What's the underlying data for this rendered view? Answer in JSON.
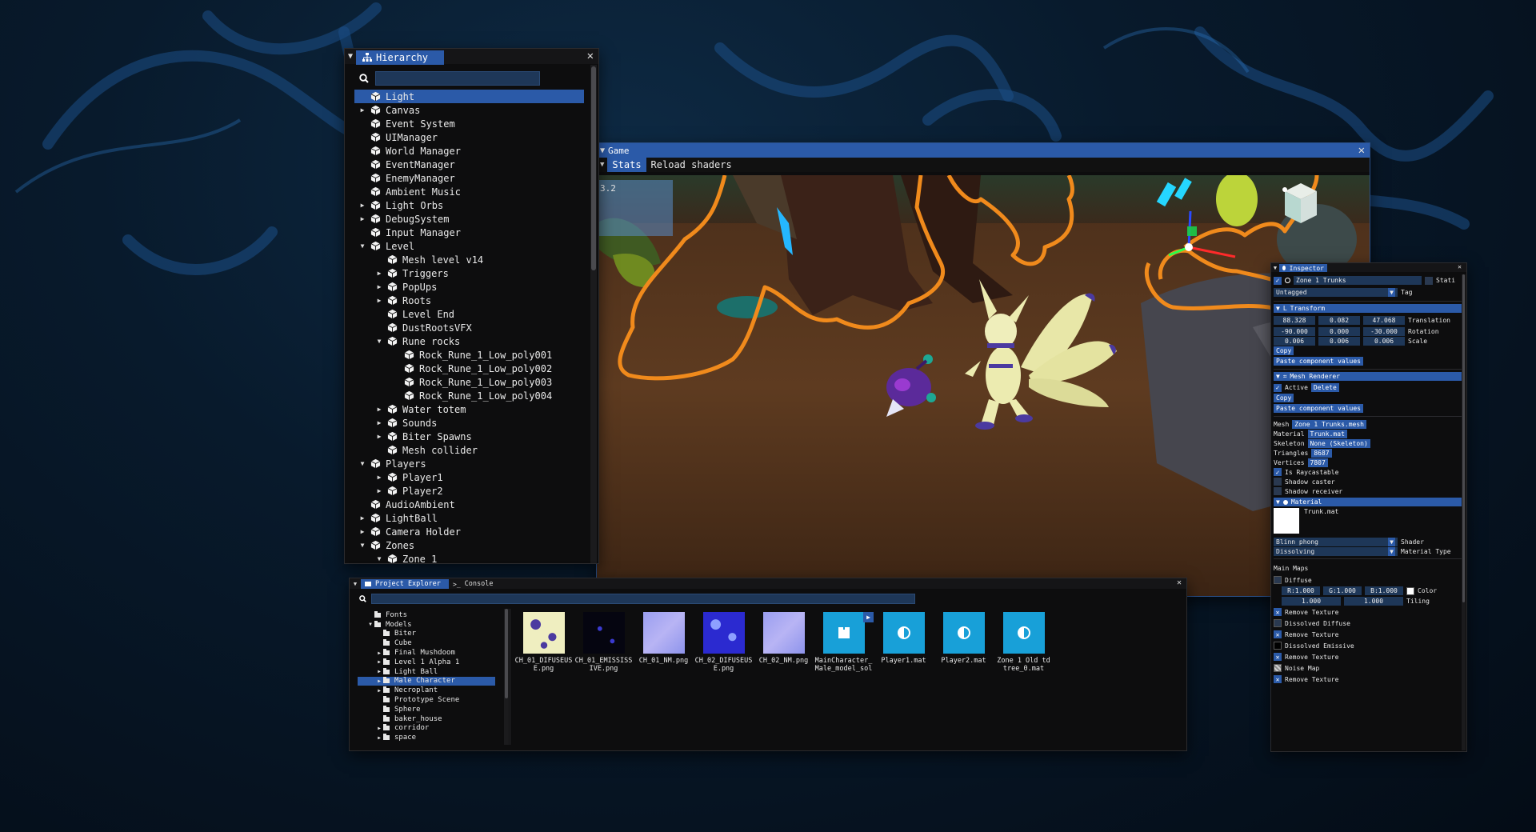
{
  "hierarchy": {
    "title": "Hierarchy",
    "items": [
      {
        "label": "Light",
        "depth": 0,
        "arrow": "",
        "selected": true
      },
      {
        "label": "Canvas",
        "depth": 0,
        "arrow": "▶"
      },
      {
        "label": "Event System",
        "depth": 0,
        "arrow": ""
      },
      {
        "label": "UIManager",
        "depth": 0,
        "arrow": ""
      },
      {
        "label": "World Manager",
        "depth": 0,
        "arrow": ""
      },
      {
        "label": "EventManager",
        "depth": 0,
        "arrow": ""
      },
      {
        "label": "EnemyManager",
        "depth": 0,
        "arrow": ""
      },
      {
        "label": "Ambient Music",
        "depth": 0,
        "arrow": ""
      },
      {
        "label": "Light Orbs",
        "depth": 0,
        "arrow": "▶"
      },
      {
        "label": "DebugSystem",
        "depth": 0,
        "arrow": "▶"
      },
      {
        "label": "Input Manager",
        "depth": 0,
        "arrow": ""
      },
      {
        "label": "Level",
        "depth": 0,
        "arrow": "▼"
      },
      {
        "label": "Mesh level v14",
        "depth": 1,
        "arrow": ""
      },
      {
        "label": "Triggers",
        "depth": 1,
        "arrow": "▶"
      },
      {
        "label": "PopUps",
        "depth": 1,
        "arrow": "▶"
      },
      {
        "label": "Roots",
        "depth": 1,
        "arrow": "▶"
      },
      {
        "label": "Level End",
        "depth": 1,
        "arrow": ""
      },
      {
        "label": "DustRootsVFX",
        "depth": 1,
        "arrow": ""
      },
      {
        "label": "Rune rocks",
        "depth": 1,
        "arrow": "▼"
      },
      {
        "label": "Rock_Rune_1_Low_poly001",
        "depth": 2,
        "arrow": ""
      },
      {
        "label": "Rock_Rune_1_Low_poly002",
        "depth": 2,
        "arrow": ""
      },
      {
        "label": "Rock_Rune_1_Low_poly003",
        "depth": 2,
        "arrow": ""
      },
      {
        "label": "Rock_Rune_1_Low_poly004",
        "depth": 2,
        "arrow": ""
      },
      {
        "label": "Water totem",
        "depth": 1,
        "arrow": "▶"
      },
      {
        "label": "Sounds",
        "depth": 1,
        "arrow": "▶"
      },
      {
        "label": "Biter Spawns",
        "depth": 1,
        "arrow": "▶"
      },
      {
        "label": "Mesh collider",
        "depth": 1,
        "arrow": ""
      },
      {
        "label": "Players",
        "depth": 0,
        "arrow": "▼"
      },
      {
        "label": "Player1",
        "depth": 1,
        "arrow": "▶"
      },
      {
        "label": "Player2",
        "depth": 1,
        "arrow": "▶"
      },
      {
        "label": "AudioAmbient",
        "depth": 0,
        "arrow": ""
      },
      {
        "label": "LightBall",
        "depth": 0,
        "arrow": "▶"
      },
      {
        "label": "Camera Holder",
        "depth": 0,
        "arrow": "▶"
      },
      {
        "label": "Zones",
        "depth": 0,
        "arrow": "▼"
      },
      {
        "label": "Zone 1",
        "depth": 1,
        "arrow": "▼"
      }
    ]
  },
  "game": {
    "title": "Game",
    "toolbar": [
      "Stats",
      "Reload shaders"
    ],
    "stats_value": "3.2"
  },
  "project": {
    "tabs": [
      "Project Explorer",
      "Console"
    ],
    "folders": [
      {
        "label": "Fonts",
        "depth": 1,
        "arrow": ""
      },
      {
        "label": "Models",
        "depth": 1,
        "arrow": "▼"
      },
      {
        "label": "Biter",
        "depth": 2,
        "arrow": ""
      },
      {
        "label": "Cube",
        "depth": 2,
        "arrow": ""
      },
      {
        "label": "Final Mushdoom",
        "depth": 2,
        "arrow": "▶"
      },
      {
        "label": "Level 1 Alpha 1",
        "depth": 2,
        "arrow": "▶"
      },
      {
        "label": "Light Ball",
        "depth": 2,
        "arrow": "▶"
      },
      {
        "label": "Male Character",
        "depth": 2,
        "arrow": "▶",
        "selected": true
      },
      {
        "label": "Necroplant",
        "depth": 2,
        "arrow": "▶"
      },
      {
        "label": "Prototype Scene",
        "depth": 2,
        "arrow": ""
      },
      {
        "label": "Sphere",
        "depth": 2,
        "arrow": ""
      },
      {
        "label": "baker_house",
        "depth": 2,
        "arrow": ""
      },
      {
        "label": "corridor",
        "depth": 2,
        "arrow": "▶"
      },
      {
        "label": "space",
        "depth": 2,
        "arrow": "▶"
      }
    ],
    "assets": [
      {
        "label": "CH_01_DIFUSEUSE.png",
        "kind": "diffuse1"
      },
      {
        "label": "CH_01_EMISSISSIVE.png",
        "kind": "emissive"
      },
      {
        "label": "CH_01_NM.png",
        "kind": "normal"
      },
      {
        "label": "CH_02_DIFUSEUSE.png",
        "kind": "diffuse2"
      },
      {
        "label": "CH_02_NM.png",
        "kind": "normal"
      },
      {
        "label": "MainCharacter_Male_model_sol",
        "kind": "model"
      },
      {
        "label": "Player1.mat",
        "kind": "mat"
      },
      {
        "label": "Player2.mat",
        "kind": "mat"
      },
      {
        "label": "Zone 1 Old td tree_0.mat",
        "kind": "mat"
      }
    ]
  },
  "inspector": {
    "title": "Inspector",
    "object_name": "Zone 1 Trunks",
    "static_label": "Stati",
    "tag_value": "Untagged",
    "tag_label": "Tag",
    "transform": {
      "title": "Transform",
      "translation": [
        "88.328",
        "0.082",
        "47.068"
      ],
      "rotation": [
        "-90.000",
        "0.000",
        "-30.000"
      ],
      "scale": [
        "0.006",
        "0.006",
        "0.006"
      ],
      "labels": [
        "Translation",
        "Rotation",
        "Scale"
      ],
      "copy": "Copy",
      "paste": "Paste component values"
    },
    "mesh_renderer": {
      "title": "Mesh Renderer",
      "active_label": "Active",
      "delete": "Delete",
      "copy": "Copy",
      "paste": "Paste component values",
      "mesh_label": "Mesh",
      "mesh_value": "Zone 1 Trunks.mesh",
      "material_label": "Material",
      "material_value": "Trunk.mat",
      "skeleton_label": "Skeleton",
      "skeleton_value": "None (Skeleton)",
      "triangles_label": "Triangles",
      "triangles_value": "8687",
      "vertices_label": "Vertices",
      "vertices_value": "7807",
      "raycast_label": "Is Raycastable",
      "shadow_caster": "Shadow caster",
      "shadow_receiver": "Shadow receiver"
    },
    "material": {
      "title": "Material",
      "file": "Trunk.mat",
      "shader_value": "Blinn phong",
      "shader_label": "Shader",
      "type_value": "Dissolving",
      "type_label": "Material Type",
      "main_maps": "Main Maps",
      "diffuse": "Diffuse",
      "r": "R:1.000",
      "g": "G:1.000",
      "b": "B:1.000",
      "color_label": "Color",
      "tiling": [
        "1.000",
        "1.000"
      ],
      "tiling_label": "Tiling",
      "remove_texture": "Remove Texture",
      "dissolved_diffuse": "Dissolved Diffuse",
      "dissolved_emissive": "Dissolved Emissive",
      "noise_map": "Noise Map"
    }
  },
  "colors": {
    "accent": "#2b5aa8",
    "field": "#1e3758",
    "outline": "#f08a1c"
  }
}
